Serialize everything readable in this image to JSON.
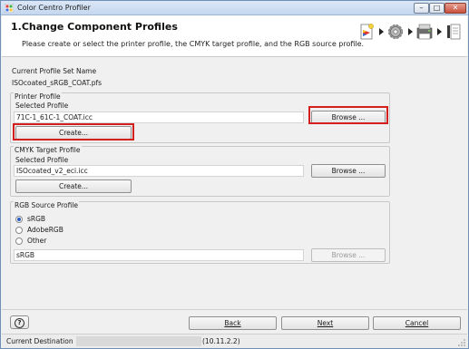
{
  "window": {
    "title": "Color Centro Profiler",
    "buttons": {
      "minimize": "–",
      "maximize": "□",
      "close": "✕"
    }
  },
  "header": {
    "title": "1.Change Component Profiles",
    "description": "Please create or select the printer profile, the CMYK target profile, and the RGB source profile."
  },
  "step_icons": [
    "printer-profile-icon",
    "gear-icon",
    "printer-icon",
    "document-icon"
  ],
  "profile_set": {
    "label": "Current Profile Set Name",
    "value": "ISOcoated_sRGB_COAT.pfs"
  },
  "printer_profile": {
    "group_title": "Printer Profile",
    "selected_label": "Selected Profile",
    "selected_value": "71C-1_61C-1_COAT.icc",
    "browse_label": "Browse ...",
    "create_label": "Create..."
  },
  "cmyk_profile": {
    "group_title": "CMYK Target Profile",
    "selected_label": "Selected Profile",
    "selected_value": "ISOcoated_v2_eci.icc",
    "browse_label": "Browse ...",
    "create_label": "Create..."
  },
  "rgb_profile": {
    "group_title": "RGB Source Profile",
    "options": [
      "sRGB",
      "AdobeRGB",
      "Other"
    ],
    "selected": "sRGB",
    "field_value": "sRGB",
    "browse_label": "Browse ..."
  },
  "footer": {
    "help_label": "?",
    "back_label": "Back",
    "next_label": "Next",
    "cancel_label": "Cancel"
  },
  "status": {
    "label": "Current Destination",
    "ip": "(10.11.2.2)"
  },
  "colors": {
    "highlight": "#d41f1f",
    "title_bar": "#c4d7ef",
    "radio_dot": "#2a5bbf"
  }
}
